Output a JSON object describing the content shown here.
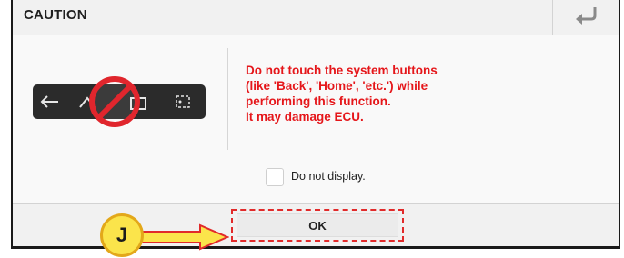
{
  "dialog": {
    "title": "CAUTION",
    "warning_text": "Do not touch the system buttons\n(like 'Back', 'Home', 'etc.') while\nperforming this function.\nIt may damage ECU.",
    "checkbox_label": "Do not display.",
    "checkbox_checked": false,
    "ok_label": "OK",
    "back_icon": "return-arrow-icon",
    "illustration_icon": "prohibited-system-buttons-icon"
  },
  "annotation": {
    "marker_label": "J",
    "accent_color": "#e12a2a",
    "marker_color": "#fbe44b"
  },
  "colors": {
    "warning_text": "#e5161a",
    "title_text": "#1f1f1f"
  }
}
